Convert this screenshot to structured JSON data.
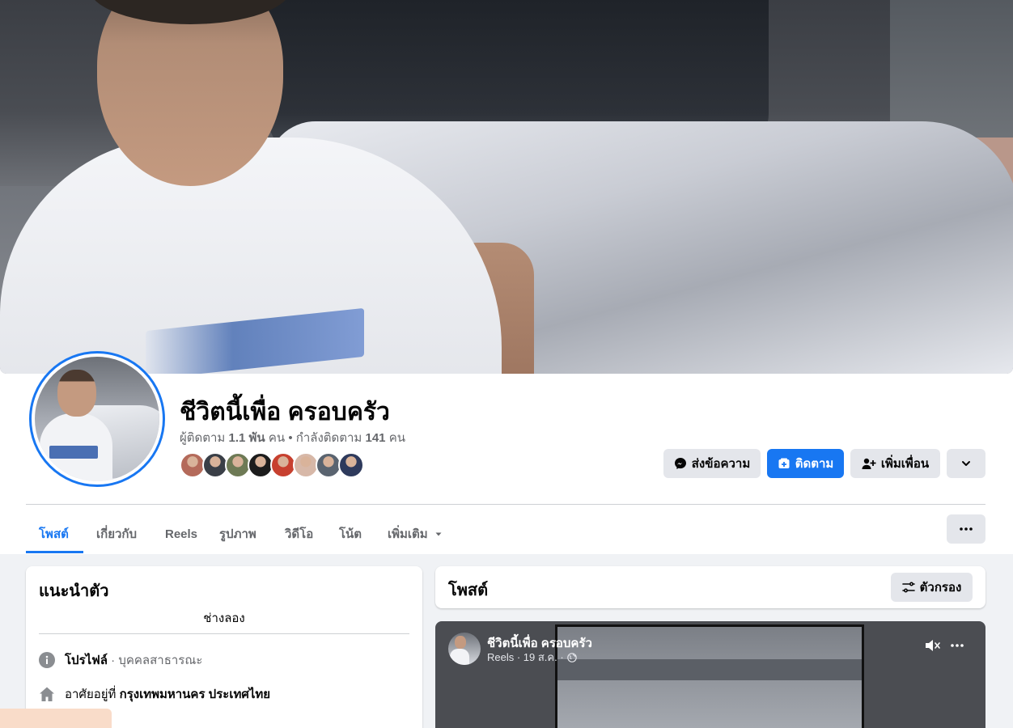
{
  "profile": {
    "name": "ชีวิตนี้เพื่อ ครอบครัว",
    "followers_label": "ผู้ติดตาม",
    "followers_count": "1.1 พัน",
    "followers_unit": "คน",
    "separator": "•",
    "following_label": "กำลังติดตาม",
    "following_count": "141",
    "following_unit": "คน",
    "friend_avatar_colors": [
      "#b46a5a",
      "#3a3f47",
      "#6e7a55",
      "#1c1c1c",
      "#c7402f",
      "#d7b8a8",
      "#5a6470",
      "#2e3a5c"
    ]
  },
  "actions": {
    "message_label": "ส่งข้อความ",
    "follow_label": "ติดตาม",
    "add_friend_label": "เพิ่มเพื่อน"
  },
  "tabs": [
    {
      "label": "โพสต์"
    },
    {
      "label": "เกี่ยวกับ"
    },
    {
      "label": "Reels"
    },
    {
      "label": "รูปภาพ"
    },
    {
      "label": "วิดีโอ"
    },
    {
      "label": "โน้ต"
    },
    {
      "label": "เพิ่มเติม"
    }
  ],
  "intro": {
    "title": "แนะนำตัว",
    "bio": "ช่างลอง",
    "profile_label": "โปรไฟล์",
    "profile_type": "· บุคคลสาธารณะ",
    "lives_label": "อาศัยอยู่ที่",
    "lives_value": "กรุงเทพมหานคร ประเทศไทย"
  },
  "posts": {
    "title": "โพสต์",
    "filter_label": "ตัวกรอง"
  },
  "reel": {
    "author": "ชีวิตนี้เพื่อ ครอบครัว",
    "meta": "Reels · 19 ส.ค. ·"
  },
  "colors": {
    "accent": "#1877f2",
    "button_gray": "#e4e6eb",
    "page_bg": "#f0f2f5"
  }
}
